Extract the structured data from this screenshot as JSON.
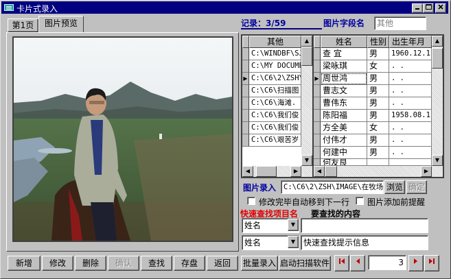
{
  "window": {
    "title": "卡片式录入"
  },
  "tabs": [
    {
      "label": "第1页"
    },
    {
      "label": "图片预览"
    }
  ],
  "record": {
    "label": "记录：3/59"
  },
  "image_field": {
    "label": "图片字段名",
    "value": "其他"
  },
  "left_grid": {
    "header": "其他",
    "rows": [
      "C:\\WINDBF\\SJ",
      "C:\\MY DOCUMEN",
      "C:\\C6\\2\\ZSH\\",
      "C:\\C6\\扫描图",
      "C:\\C6\\海滩.",
      "C:\\C6\\我们俊",
      "C:\\C6\\我们俊",
      "C:\\C6\\艰苦岁"
    ]
  },
  "right_grid": {
    "headers": [
      "姓名",
      "性别",
      "出生年月"
    ],
    "rows": [
      [
        "查  宜",
        "男",
        "1960.12.1"
      ],
      [
        "梁咏琪",
        "女",
        ".  ."
      ],
      [
        "周世鸿",
        "男",
        ".  ."
      ],
      [
        "曹志文",
        "男",
        ".  ."
      ],
      [
        "曹伟东",
        "男",
        ".  ."
      ],
      [
        "陈阳福",
        "男",
        "1958.08.1"
      ],
      [
        "方全美",
        "女",
        ".  ."
      ],
      [
        "付伟才",
        "男",
        ".  ."
      ],
      [
        "何建中",
        "男",
        ".  ."
      ],
      [
        "何友良",
        "",
        ""
      ]
    ]
  },
  "image_input": {
    "label": "图片录入",
    "value": "C:\\C6\\2\\ZSH\\IMAGE\\在牧场",
    "browse": "浏览",
    "confirm": "确定"
  },
  "options": [
    {
      "label": "修改完毕自动移到下一行",
      "checked": false
    },
    {
      "label": "图片添加前提醒",
      "checked": false
    }
  ],
  "quick_search": {
    "field_label": "快速查找项目名",
    "content_label": "要查找的内容",
    "field1_value": "姓名",
    "field2_value": "姓名",
    "hint": "快速查找提示信息"
  },
  "toolbar": {
    "buttons": [
      {
        "label": "新增",
        "disabled": false
      },
      {
        "label": "修改",
        "disabled": false
      },
      {
        "label": "删除",
        "disabled": false
      },
      {
        "label": "确认",
        "disabled": true
      },
      {
        "label": "查找",
        "disabled": false
      },
      {
        "label": "存盘",
        "disabled": false
      },
      {
        "label": "返回",
        "disabled": false
      },
      {
        "label": "批量录入",
        "disabled": false
      },
      {
        "label": "启动扫描软件",
        "disabled": false
      }
    ],
    "page_value": "3"
  },
  "colors": {
    "titlebar": "#000080",
    "label_blue": "#0000a0",
    "label_red": "#e00000",
    "face": "#c0c0c0"
  }
}
